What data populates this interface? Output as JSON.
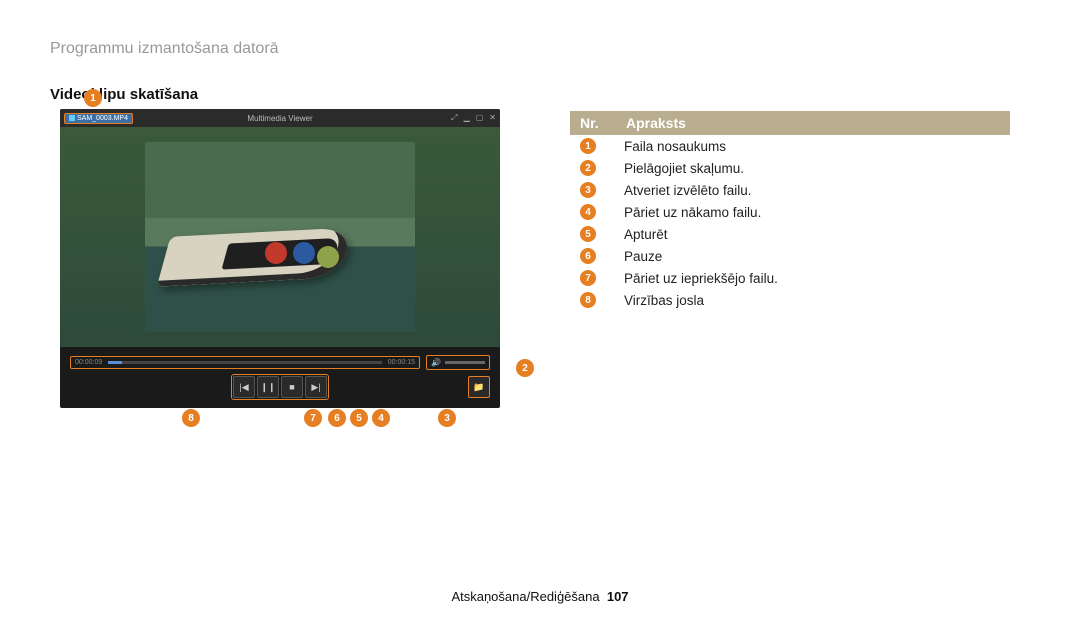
{
  "breadcrumb": "Programmu izmantošana datorā",
  "section_title": "Videoklipu skatīšana",
  "viewer": {
    "file_name": "SAM_0003.MP4",
    "app_title": "Multimedia Viewer",
    "progress": {
      "current": "00:00:09",
      "total": "00:00:15"
    }
  },
  "table": {
    "header_nr": "Nr.",
    "header_desc": "Apraksts",
    "rows": [
      {
        "n": "1",
        "text": "Faila nosaukums"
      },
      {
        "n": "2",
        "text": "Pielāgojiet skaļumu."
      },
      {
        "n": "3",
        "text": "Atveriet izvēlēto failu."
      },
      {
        "n": "4",
        "text": "Pāriet uz nākamo failu."
      },
      {
        "n": "5",
        "text": "Apturēt"
      },
      {
        "n": "6",
        "text": "Pauze"
      },
      {
        "n": "7",
        "text": "Pāriet uz iepriekšējo failu."
      },
      {
        "n": "8",
        "text": "Virzības josla"
      }
    ]
  },
  "callouts": {
    "c1": "1",
    "c2": "2",
    "c3": "3",
    "c4": "4",
    "c5": "5",
    "c6": "6",
    "c7": "7",
    "c8": "8"
  },
  "footer": {
    "section": "Atskaņošana/Rediģēšana",
    "page": "107"
  }
}
